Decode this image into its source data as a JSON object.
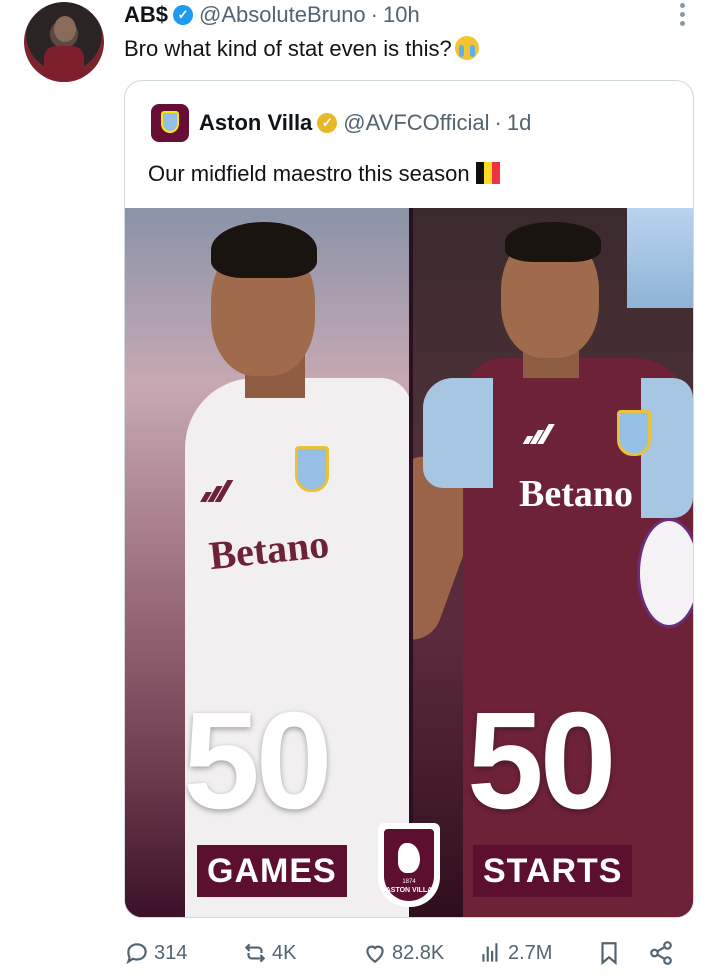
{
  "tweet": {
    "author_name": "AB$",
    "handle": "@AbsoluteBruno",
    "separator": "·",
    "time": "10h",
    "text": "Bro what kind of stat even is this?"
  },
  "quoted": {
    "author_name": "Aston Villa",
    "handle": "@AVFCOfficial",
    "separator": "·",
    "time": "1d",
    "text": "Our midfield maestro this season",
    "media": {
      "left_sponsor": "Betano",
      "right_sponsor": "Betano",
      "left_number": "50",
      "left_label": "GAMES",
      "right_number": "50",
      "right_label": "STARTS",
      "crest_year": "1874",
      "crest_text": "ASTON VILLA"
    }
  },
  "actions": {
    "replies": "314",
    "reposts": "4K",
    "likes": "82.8K",
    "views": "2.7M"
  },
  "colors": {
    "verified_blue": "#1d9bf0",
    "verified_gold": "#e8b829",
    "villa_claret": "#5c0f2e",
    "muted_text": "#536471"
  },
  "icons": [
    "verified-icon",
    "more-icon",
    "crying-emoji",
    "belgium-flag-emoji",
    "reply-icon",
    "repost-icon",
    "like-icon",
    "views-icon",
    "bookmark-icon",
    "share-icon"
  ]
}
